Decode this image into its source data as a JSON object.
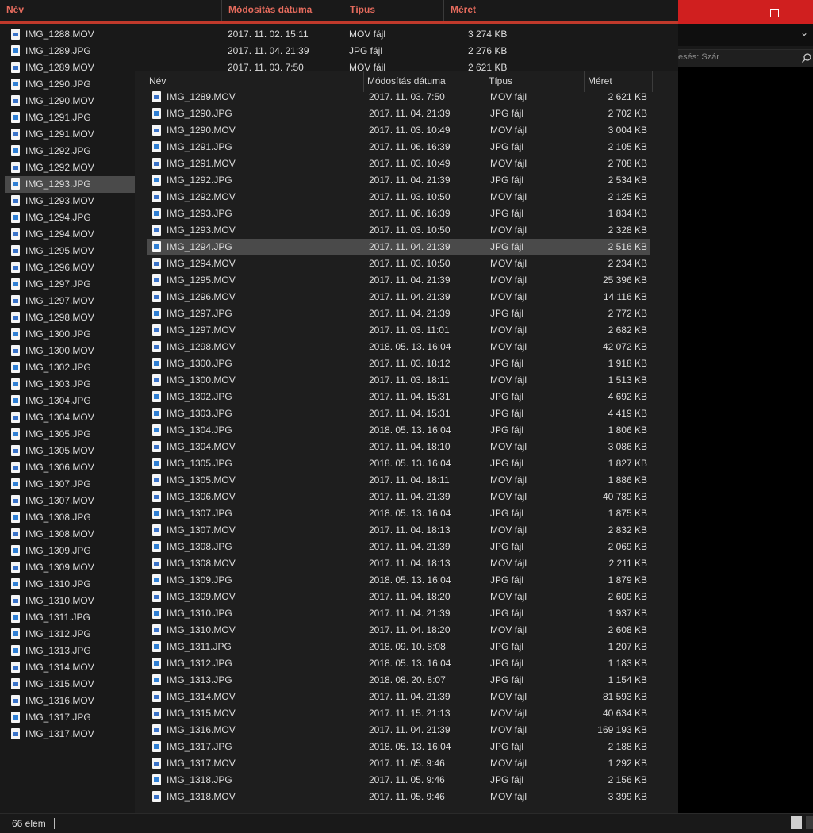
{
  "back_window": {
    "headers": {
      "name": "Név",
      "date": "Módosítás dátuma",
      "type": "Típus",
      "size": "Méret"
    },
    "top_rows": [
      {
        "name": "IMG_1288.MOV",
        "date": "2017. 11. 02. 15:11",
        "type": "MOV fájl",
        "size": "3 274 KB"
      },
      {
        "name": "IMG_1289.JPG",
        "date": "2017. 11. 04. 21:39",
        "type": "JPG fájl",
        "size": "2 276 KB"
      },
      {
        "name": "IMG_1289.MOV",
        "date": "2017. 11. 03. 7:50",
        "type": "MOV fájl",
        "size": "2 621 KB"
      }
    ],
    "left_items": [
      {
        "name": "IMG_1288.MOV",
        "kind": "mov"
      },
      {
        "name": "IMG_1289.JPG",
        "kind": "jpg"
      },
      {
        "name": "IMG_1289.MOV",
        "kind": "mov"
      },
      {
        "name": "IMG_1290.JPG",
        "kind": "jpg"
      },
      {
        "name": "IMG_1290.MOV",
        "kind": "mov"
      },
      {
        "name": "IMG_1291.JPG",
        "kind": "jpg"
      },
      {
        "name": "IMG_1291.MOV",
        "kind": "mov"
      },
      {
        "name": "IMG_1292.JPG",
        "kind": "jpg"
      },
      {
        "name": "IMG_1292.MOV",
        "kind": "mov"
      },
      {
        "name": "IMG_1293.JPG",
        "kind": "jpg",
        "selected": true
      },
      {
        "name": "IMG_1293.MOV",
        "kind": "mov"
      },
      {
        "name": "IMG_1294.JPG",
        "kind": "jpg"
      },
      {
        "name": "IMG_1294.MOV",
        "kind": "mov"
      },
      {
        "name": "IMG_1295.MOV",
        "kind": "mov"
      },
      {
        "name": "IMG_1296.MOV",
        "kind": "mov"
      },
      {
        "name": "IMG_1297.JPG",
        "kind": "jpg"
      },
      {
        "name": "IMG_1297.MOV",
        "kind": "mov"
      },
      {
        "name": "IMG_1298.MOV",
        "kind": "mov"
      },
      {
        "name": "IMG_1300.JPG",
        "kind": "jpg"
      },
      {
        "name": "IMG_1300.MOV",
        "kind": "mov"
      },
      {
        "name": "IMG_1302.JPG",
        "kind": "jpg"
      },
      {
        "name": "IMG_1303.JPG",
        "kind": "jpg"
      },
      {
        "name": "IMG_1304.JPG",
        "kind": "jpg"
      },
      {
        "name": "IMG_1304.MOV",
        "kind": "mov"
      },
      {
        "name": "IMG_1305.JPG",
        "kind": "jpg"
      },
      {
        "name": "IMG_1305.MOV",
        "kind": "mov"
      },
      {
        "name": "IMG_1306.MOV",
        "kind": "mov"
      },
      {
        "name": "IMG_1307.JPG",
        "kind": "jpg"
      },
      {
        "name": "IMG_1307.MOV",
        "kind": "mov"
      },
      {
        "name": "IMG_1308.JPG",
        "kind": "jpg"
      },
      {
        "name": "IMG_1308.MOV",
        "kind": "mov"
      },
      {
        "name": "IMG_1309.JPG",
        "kind": "jpg"
      },
      {
        "name": "IMG_1309.MOV",
        "kind": "mov"
      },
      {
        "name": "IMG_1310.JPG",
        "kind": "jpg"
      },
      {
        "name": "IMG_1310.MOV",
        "kind": "mov"
      },
      {
        "name": "IMG_1311.JPG",
        "kind": "jpg"
      },
      {
        "name": "IMG_1312.JPG",
        "kind": "jpg"
      },
      {
        "name": "IMG_1313.JPG",
        "kind": "jpg"
      },
      {
        "name": "IMG_1314.MOV",
        "kind": "mov"
      },
      {
        "name": "IMG_1315.MOV",
        "kind": "mov"
      },
      {
        "name": "IMG_1316.MOV",
        "kind": "mov"
      },
      {
        "name": "IMG_1317.JPG",
        "kind": "jpg"
      },
      {
        "name": "IMG_1317.MOV",
        "kind": "mov"
      }
    ]
  },
  "right_window": {
    "search_placeholder": "esés: Szár",
    "icons": {
      "minimize": "minimize-icon",
      "maximize": "maximize-icon",
      "close": "close-icon",
      "dropdown": "chevron-down-icon",
      "search": "search-icon"
    }
  },
  "front_window": {
    "headers": {
      "name": "Név",
      "date": "Módosítás dátuma",
      "type": "Típus",
      "size": "Méret"
    },
    "rows": [
      {
        "name": "IMG_1289.MOV",
        "date": "2017. 11. 03. 7:50",
        "type": "MOV fájl",
        "size": "2 621 KB",
        "kind": "mov"
      },
      {
        "name": "IMG_1290.JPG",
        "date": "2017. 11. 04. 21:39",
        "type": "JPG fájl",
        "size": "2 702 KB",
        "kind": "jpg"
      },
      {
        "name": "IMG_1290.MOV",
        "date": "2017. 11. 03. 10:49",
        "type": "MOV fájl",
        "size": "3 004 KB",
        "kind": "mov"
      },
      {
        "name": "IMG_1291.JPG",
        "date": "2017. 11. 06. 16:39",
        "type": "JPG fájl",
        "size": "2 105 KB",
        "kind": "jpg"
      },
      {
        "name": "IMG_1291.MOV",
        "date": "2017. 11. 03. 10:49",
        "type": "MOV fájl",
        "size": "2 708 KB",
        "kind": "mov"
      },
      {
        "name": "IMG_1292.JPG",
        "date": "2017. 11. 04. 21:39",
        "type": "JPG fájl",
        "size": "2 534 KB",
        "kind": "jpg"
      },
      {
        "name": "IMG_1292.MOV",
        "date": "2017. 11. 03. 10:50",
        "type": "MOV fájl",
        "size": "2 125 KB",
        "kind": "mov"
      },
      {
        "name": "IMG_1293.JPG",
        "date": "2017. 11. 06. 16:39",
        "type": "JPG fájl",
        "size": "1 834 KB",
        "kind": "jpg"
      },
      {
        "name": "IMG_1293.MOV",
        "date": "2017. 11. 03. 10:50",
        "type": "MOV fájl",
        "size": "2 328 KB",
        "kind": "mov"
      },
      {
        "name": "IMG_1294.JPG",
        "date": "2017. 11. 04. 21:39",
        "type": "JPG fájl",
        "size": "2 516 KB",
        "kind": "jpg",
        "selected": true
      },
      {
        "name": "IMG_1294.MOV",
        "date": "2017. 11. 03. 10:50",
        "type": "MOV fájl",
        "size": "2 234 KB",
        "kind": "mov"
      },
      {
        "name": "IMG_1295.MOV",
        "date": "2017. 11. 04. 21:39",
        "type": "MOV fájl",
        "size": "25 396 KB",
        "kind": "mov"
      },
      {
        "name": "IMG_1296.MOV",
        "date": "2017. 11. 04. 21:39",
        "type": "MOV fájl",
        "size": "14 116 KB",
        "kind": "mov"
      },
      {
        "name": "IMG_1297.JPG",
        "date": "2017. 11. 04. 21:39",
        "type": "JPG fájl",
        "size": "2 772 KB",
        "kind": "jpg"
      },
      {
        "name": "IMG_1297.MOV",
        "date": "2017. 11. 03. 11:01",
        "type": "MOV fájl",
        "size": "2 682 KB",
        "kind": "mov"
      },
      {
        "name": "IMG_1298.MOV",
        "date": "2018. 05. 13. 16:04",
        "type": "MOV fájl",
        "size": "42 072 KB",
        "kind": "mov"
      },
      {
        "name": "IMG_1300.JPG",
        "date": "2017. 11. 03. 18:12",
        "type": "JPG fájl",
        "size": "1 918 KB",
        "kind": "jpg"
      },
      {
        "name": "IMG_1300.MOV",
        "date": "2017. 11. 03. 18:11",
        "type": "MOV fájl",
        "size": "1 513 KB",
        "kind": "mov"
      },
      {
        "name": "IMG_1302.JPG",
        "date": "2017. 11. 04. 15:31",
        "type": "JPG fájl",
        "size": "4 692 KB",
        "kind": "jpg"
      },
      {
        "name": "IMG_1303.JPG",
        "date": "2017. 11. 04. 15:31",
        "type": "JPG fájl",
        "size": "4 419 KB",
        "kind": "jpg"
      },
      {
        "name": "IMG_1304.JPG",
        "date": "2018. 05. 13. 16:04",
        "type": "JPG fájl",
        "size": "1 806 KB",
        "kind": "jpg"
      },
      {
        "name": "IMG_1304.MOV",
        "date": "2017. 11. 04. 18:10",
        "type": "MOV fájl",
        "size": "3 086 KB",
        "kind": "mov"
      },
      {
        "name": "IMG_1305.JPG",
        "date": "2018. 05. 13. 16:04",
        "type": "JPG fájl",
        "size": "1 827 KB",
        "kind": "jpg"
      },
      {
        "name": "IMG_1305.MOV",
        "date": "2017. 11. 04. 18:11",
        "type": "MOV fájl",
        "size": "1 886 KB",
        "kind": "mov"
      },
      {
        "name": "IMG_1306.MOV",
        "date": "2017. 11. 04. 21:39",
        "type": "MOV fájl",
        "size": "40 789 KB",
        "kind": "mov"
      },
      {
        "name": "IMG_1307.JPG",
        "date": "2018. 05. 13. 16:04",
        "type": "JPG fájl",
        "size": "1 875 KB",
        "kind": "jpg"
      },
      {
        "name": "IMG_1307.MOV",
        "date": "2017. 11. 04. 18:13",
        "type": "MOV fájl",
        "size": "2 832 KB",
        "kind": "mov"
      },
      {
        "name": "IMG_1308.JPG",
        "date": "2017. 11. 04. 21:39",
        "type": "JPG fájl",
        "size": "2 069 KB",
        "kind": "jpg"
      },
      {
        "name": "IMG_1308.MOV",
        "date": "2017. 11. 04. 18:13",
        "type": "MOV fájl",
        "size": "2 211 KB",
        "kind": "mov"
      },
      {
        "name": "IMG_1309.JPG",
        "date": "2018. 05. 13. 16:04",
        "type": "JPG fájl",
        "size": "1 879 KB",
        "kind": "jpg"
      },
      {
        "name": "IMG_1309.MOV",
        "date": "2017. 11. 04. 18:20",
        "type": "MOV fájl",
        "size": "2 609 KB",
        "kind": "mov"
      },
      {
        "name": "IMG_1310.JPG",
        "date": "2017. 11. 04. 21:39",
        "type": "JPG fájl",
        "size": "1 937 KB",
        "kind": "jpg"
      },
      {
        "name": "IMG_1310.MOV",
        "date": "2017. 11. 04. 18:20",
        "type": "MOV fájl",
        "size": "2 608 KB",
        "kind": "mov"
      },
      {
        "name": "IMG_1311.JPG",
        "date": "2018. 09. 10. 8:08",
        "type": "JPG fájl",
        "size": "1 207 KB",
        "kind": "jpg"
      },
      {
        "name": "IMG_1312.JPG",
        "date": "2018. 05. 13. 16:04",
        "type": "JPG fájl",
        "size": "1 183 KB",
        "kind": "jpg"
      },
      {
        "name": "IMG_1313.JPG",
        "date": "2018. 08. 20. 8:07",
        "type": "JPG fájl",
        "size": "1 154 KB",
        "kind": "jpg"
      },
      {
        "name": "IMG_1314.MOV",
        "date": "2017. 11. 04. 21:39",
        "type": "MOV fájl",
        "size": "81 593 KB",
        "kind": "mov"
      },
      {
        "name": "IMG_1315.MOV",
        "date": "2017. 11. 15. 21:13",
        "type": "MOV fájl",
        "size": "40 634 KB",
        "kind": "mov"
      },
      {
        "name": "IMG_1316.MOV",
        "date": "2017. 11. 04. 21:39",
        "type": "MOV fájl",
        "size": "169 193 KB",
        "kind": "mov"
      },
      {
        "name": "IMG_1317.JPG",
        "date": "2018. 05. 13. 16:04",
        "type": "JPG fájl",
        "size": "2 188 KB",
        "kind": "jpg"
      },
      {
        "name": "IMG_1317.MOV",
        "date": "2017. 11. 05. 9:46",
        "type": "MOV fájl",
        "size": "1 292 KB",
        "kind": "mov"
      },
      {
        "name": "IMG_1318.JPG",
        "date": "2017. 11. 05. 9:46",
        "type": "JPG fájl",
        "size": "2 156 KB",
        "kind": "jpg"
      },
      {
        "name": "IMG_1318.MOV",
        "date": "2017. 11. 05. 9:46",
        "type": "MOV fájl",
        "size": "3 399 KB",
        "kind": "mov"
      }
    ]
  },
  "status_bar": {
    "item_count": "66 elem"
  },
  "colors": {
    "accent_red": "#d01f1f",
    "header_red_text": "#e56b5d",
    "selection": "#4a4a4a",
    "background": "#191919"
  }
}
